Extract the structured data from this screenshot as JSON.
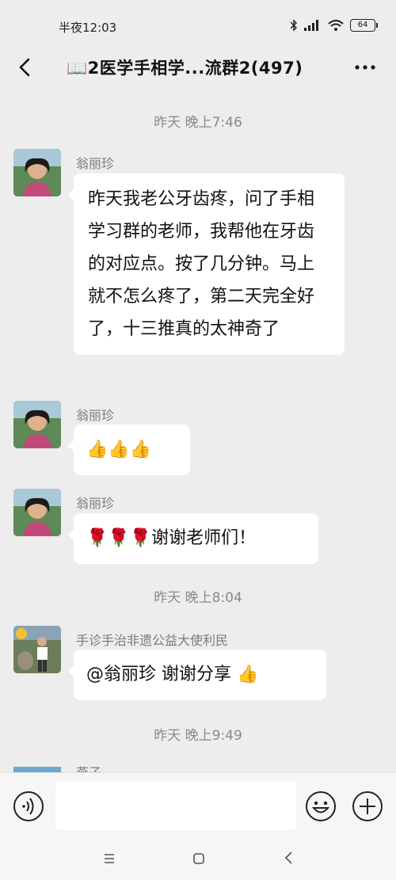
{
  "status_bar": {
    "time": "半夜12:03",
    "battery": "64"
  },
  "header": {
    "title": "📖2医学手相学...流群2(497)"
  },
  "messages": [
    {
      "timestamp": "昨天 晚上7:46"
    },
    {
      "sender": "翁丽珍",
      "text": "昨天我老公牙齿疼，问了手相学习群的老师，我帮他在牙齿的对应点。按了几分钟。马上就不怎么疼了，第二天完全好了，十三推真的太神奇了"
    },
    {
      "sender": "翁丽珍",
      "text": "👍👍👍"
    },
    {
      "sender": "翁丽珍",
      "text": "🌹🌹🌹谢谢老师们！"
    },
    {
      "timestamp": "昨天 晚上8:04"
    },
    {
      "sender": "手诊手治非遗公益大使利民",
      "text": "@翁丽珍  谢谢分享 👍"
    },
    {
      "timestamp": "昨天 晚上9:49"
    },
    {
      "sender": "燕子"
    }
  ],
  "input": {
    "placeholder": ""
  },
  "colors": {
    "background": "#ededed",
    "bubble": "#ffffff",
    "meta_text": "#8a8a8a"
  }
}
